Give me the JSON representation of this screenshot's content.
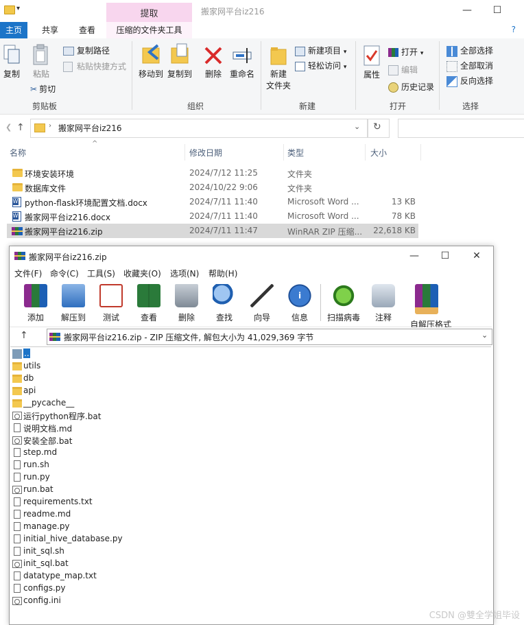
{
  "explorer": {
    "contextual_tab": "提取",
    "window_title": "搬家网平台iz216",
    "window_controls": {
      "minimize": "—",
      "maximize": "☐"
    },
    "ribbon_tabs": [
      "主页",
      "共享",
      "查看",
      "压缩的文件夹工具"
    ],
    "ribbon": {
      "clipboard": {
        "group_label": "剪贴板",
        "copy": "复制",
        "paste": "粘贴",
        "copy_path": "复制路径",
        "paste_shortcut": "粘贴快捷方式",
        "cut": "剪切"
      },
      "organize": {
        "group_label": "组织",
        "move_to": "移动到",
        "copy_to": "复制到",
        "delete": "删除",
        "rename": "重命名"
      },
      "new": {
        "group_label": "新建",
        "new_folder_line1": "新建",
        "new_folder_line2": "文件夹",
        "new_item": "新建项目",
        "easy_access": "轻松访问"
      },
      "open": {
        "group_label": "打开",
        "properties": "属性",
        "open": "打开",
        "edit": "编辑",
        "history": "历史记录"
      },
      "select": {
        "group_label": "选择",
        "select_all": "全部选择",
        "select_none": "全部取消",
        "invert_selection": "反向选择"
      }
    },
    "address": {
      "crumb": "搬家网平台iz216"
    },
    "columns": {
      "name": "名称",
      "date": "修改日期",
      "type": "类型",
      "size": "大小"
    },
    "files": [
      {
        "name": "环境安装环境",
        "date": "2024/7/12 11:25",
        "type": "文件夹",
        "size": "",
        "icon": "folder"
      },
      {
        "name": "数据库文件",
        "date": "2024/10/22 9:06",
        "type": "文件夹",
        "size": "",
        "icon": "folder"
      },
      {
        "name": "python-flask环境配置文档.docx",
        "date": "2024/7/11 11:40",
        "type": "Microsoft Word ...",
        "size": "13 KB",
        "icon": "word"
      },
      {
        "name": "搬家网平台iz216.docx",
        "date": "2024/7/11 11:40",
        "type": "Microsoft Word ...",
        "size": "78 KB",
        "icon": "word"
      },
      {
        "name": "搬家网平台iz216.zip",
        "date": "2024/7/11 11:47",
        "type": "WinRAR ZIP 压缩...",
        "size": "22,618 KB",
        "icon": "rar",
        "selected": true
      }
    ]
  },
  "winrar": {
    "title": "搬家网平台iz216.zip",
    "window_controls": {
      "minimize": "—",
      "maximize": "☐",
      "close": "✕"
    },
    "menu": [
      "文件(F)",
      "命令(C)",
      "工具(S)",
      "收藏夹(O)",
      "选项(N)",
      "帮助(H)"
    ],
    "toolbar": [
      "添加",
      "解压到",
      "测试",
      "查看",
      "删除",
      "查找",
      "向导",
      "信息",
      "扫描病毒",
      "注释",
      "自解压格式"
    ],
    "path_text": "搬家网平台iz216.zip - ZIP 压缩文件, 解包大小为 41,029,369 字节",
    "entries": [
      {
        "name": "..",
        "icon": "up",
        "selected": true
      },
      {
        "name": "utils",
        "icon": "folder"
      },
      {
        "name": "db",
        "icon": "folder"
      },
      {
        "name": "api",
        "icon": "folder"
      },
      {
        "name": "__pycache__",
        "icon": "folder"
      },
      {
        "name": "运行python程序.bat",
        "icon": "bat"
      },
      {
        "name": "说明文档.md",
        "icon": "file"
      },
      {
        "name": "安装全部.bat",
        "icon": "bat"
      },
      {
        "name": "step.md",
        "icon": "file"
      },
      {
        "name": "run.sh",
        "icon": "file"
      },
      {
        "name": "run.py",
        "icon": "file"
      },
      {
        "name": "run.bat",
        "icon": "bat"
      },
      {
        "name": "requirements.txt",
        "icon": "file"
      },
      {
        "name": "readme.md",
        "icon": "file"
      },
      {
        "name": "manage.py",
        "icon": "file"
      },
      {
        "name": "initial_hive_database.py",
        "icon": "file"
      },
      {
        "name": "init_sql.sh",
        "icon": "file"
      },
      {
        "name": "init_sql.bat",
        "icon": "bat"
      },
      {
        "name": "datatype_map.txt",
        "icon": "file"
      },
      {
        "name": "configs.py",
        "icon": "file"
      },
      {
        "name": "config.ini",
        "icon": "bat"
      }
    ]
  },
  "watermark": "CSDN @雙全学姐毕设",
  "colors": {
    "accent": "#1c74c8",
    "contextual_tab": "#f8d6ee",
    "folder": "#f3c84f",
    "selection": "#d9d9d9"
  }
}
